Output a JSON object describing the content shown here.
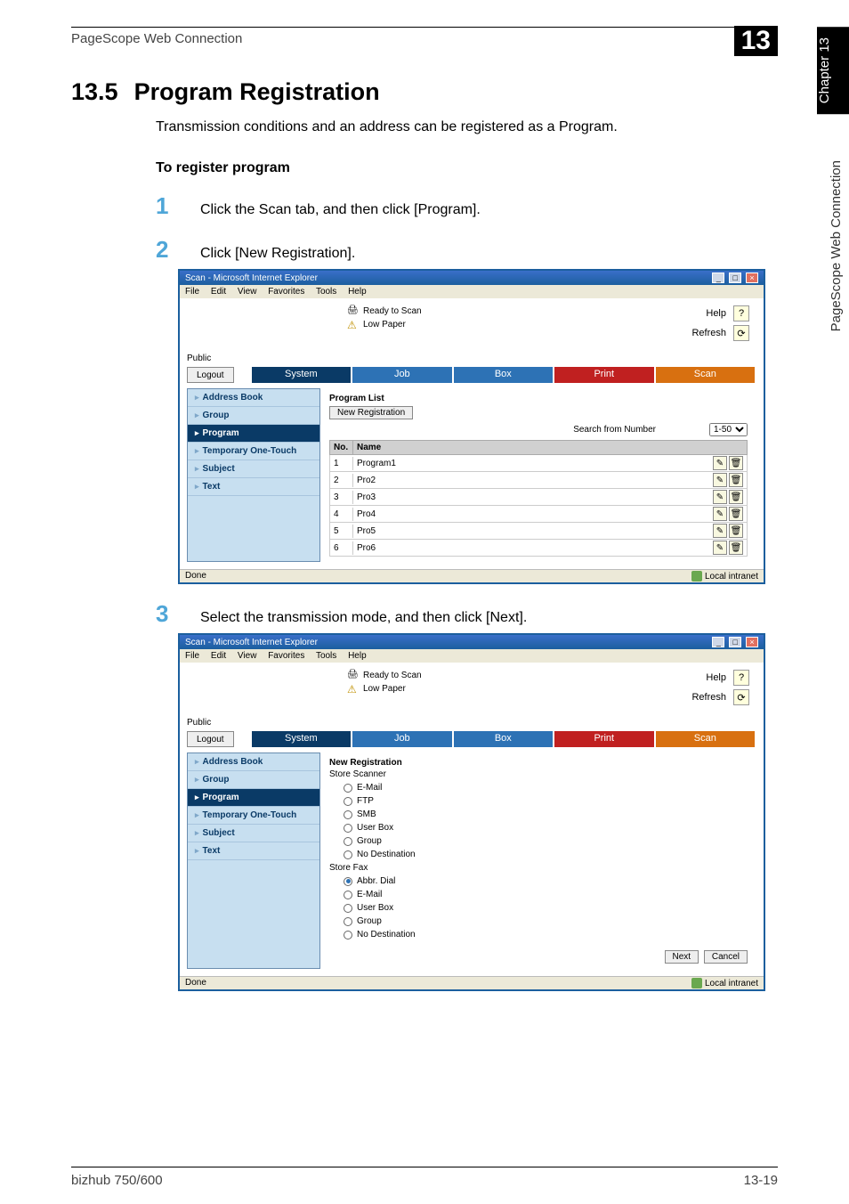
{
  "header": {
    "breadcrumb": "PageScope Web Connection",
    "chapter_badge": "13"
  },
  "section": {
    "number": "13.5",
    "title": "Program Registration",
    "intro": "Transmission conditions and an address can be registered as a Program.",
    "subheading": "To register program"
  },
  "steps": {
    "s1": {
      "num": "1",
      "text": "Click the Scan tab, and then click [Program]."
    },
    "s2": {
      "num": "2",
      "text": "Click [New Registration]."
    },
    "s3": {
      "num": "3",
      "text": "Select the transmission mode, and then click [Next]."
    }
  },
  "browser": {
    "title": "Scan - Microsoft Internet Explorer",
    "menus": {
      "file": "File",
      "edit": "Edit",
      "view": "View",
      "favorites": "Favorites",
      "tools": "Tools",
      "help": "Help"
    },
    "status": {
      "ready": "Ready to Scan",
      "lowpaper": "Low Paper"
    },
    "links": {
      "help": "Help",
      "refresh": "Refresh"
    },
    "public": "Public",
    "logout": "Logout",
    "tabs": {
      "system": "System",
      "job": "Job",
      "box": "Box",
      "print": "Print",
      "scan": "Scan"
    },
    "sidebar": {
      "address": "Address Book",
      "group": "Group",
      "program": "Program",
      "temp": "Temporary One-Touch",
      "subject": "Subject",
      "text": "Text"
    },
    "statusbar": {
      "done": "Done",
      "zone": "Local intranet"
    }
  },
  "screen1": {
    "list_title": "Program List",
    "new_reg_btn": "New Registration",
    "search_label": "Search from Number",
    "search_range": "1-50",
    "cols": {
      "no": "No.",
      "name": "Name"
    },
    "rows": [
      {
        "no": "1",
        "name": "Program1"
      },
      {
        "no": "2",
        "name": "Pro2"
      },
      {
        "no": "3",
        "name": "Pro3"
      },
      {
        "no": "4",
        "name": "Pro4"
      },
      {
        "no": "5",
        "name": "Pro5"
      },
      {
        "no": "6",
        "name": "Pro6"
      }
    ]
  },
  "screen2": {
    "heading": "New Registration",
    "group_scanner": "Store Scanner",
    "group_fax": "Store Fax",
    "scanner_opts": {
      "email": "E-Mail",
      "ftp": "FTP",
      "smb": "SMB",
      "userbox": "User Box",
      "group": "Group",
      "nodest": "No Destination"
    },
    "fax_opts": {
      "abbr": "Abbr. Dial",
      "email": "E-Mail",
      "userbox": "User Box",
      "group": "Group",
      "nodest": "No Destination"
    },
    "buttons": {
      "next": "Next",
      "cancel": "Cancel"
    }
  },
  "sidebar_page": {
    "chapter": "Chapter 13",
    "product": "PageScope Web Connection"
  },
  "footer": {
    "model": "bizhub 750/600",
    "page": "13-19"
  }
}
